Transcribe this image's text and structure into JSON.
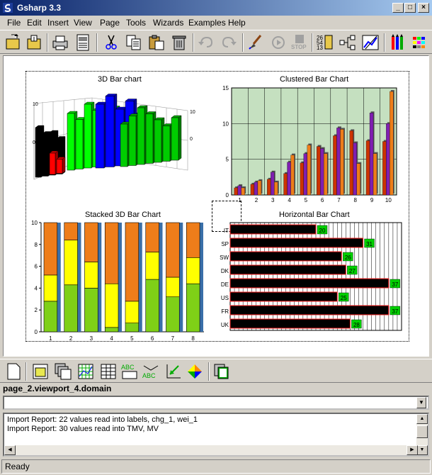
{
  "window": {
    "title": "Gsharp 3.3",
    "min": "_",
    "max": "□",
    "close": "×"
  },
  "menu": [
    "File",
    "Edit",
    "Insert",
    "View",
    "Page",
    "Tools",
    "Wizards",
    "Examples",
    "Help"
  ],
  "toolbar": [
    {
      "name": "open-icon"
    },
    {
      "name": "save-icon"
    },
    {
      "name": "print-icon"
    },
    {
      "name": "print-preview-icon"
    },
    {
      "name": "cut-icon"
    },
    {
      "name": "copy-icon"
    },
    {
      "name": "paste-icon"
    },
    {
      "name": "delete-icon"
    },
    {
      "name": "undo-icon"
    },
    {
      "name": "redo-icon"
    },
    {
      "name": "brush-icon"
    },
    {
      "name": "run-icon"
    },
    {
      "name": "stop-icon",
      "label": "STOP"
    },
    {
      "name": "data-icon"
    },
    {
      "name": "tree-icon"
    },
    {
      "name": "chart-edit-icon"
    },
    {
      "name": "pens-icon"
    },
    {
      "name": "palette-icon"
    }
  ],
  "charts": {
    "bar3d": {
      "title": "3D Bar chart",
      "ticks": [
        "10",
        "0",
        "0",
        "10"
      ]
    },
    "clustered": {
      "title": "Clustered Bar Chart"
    },
    "stacked": {
      "title": "Stacked 3D Bar Chart"
    },
    "horizontal": {
      "title": "Horizontal Bar Chart"
    }
  },
  "chart_data": [
    {
      "type": "bar",
      "title": "3D Bar chart",
      "series": [
        {
          "color": "#000000",
          "values": [
            7,
            6,
            6,
            5
          ]
        },
        {
          "color": "#ff0000",
          "values": [
            3,
            2
          ]
        },
        {
          "color": "#00ff00",
          "values": [
            8,
            7,
            9,
            8,
            7,
            8
          ]
        },
        {
          "color": "#0000ff",
          "values": [
            9,
            10,
            8,
            9,
            7
          ]
        },
        {
          "color": "#00cc00",
          "values": [
            6,
            7,
            8,
            7,
            6,
            5,
            6
          ]
        }
      ]
    },
    {
      "type": "bar",
      "title": "Clustered Bar Chart",
      "categories": [
        "1",
        "2",
        "3",
        "4",
        "5",
        "6",
        "7",
        "8",
        "9",
        "10"
      ],
      "ylim": [
        0,
        15
      ],
      "yticks": [
        "0",
        "5",
        "10",
        "15"
      ],
      "series": [
        {
          "color": "#cc3300",
          "values": [
            1,
            1.5,
            2.2,
            3.0,
            4.5,
            6.8,
            8.3,
            9.0,
            7.6,
            7.5
          ]
        },
        {
          "color": "#7f1fb0",
          "values": [
            1.3,
            1.8,
            3.2,
            4.6,
            5.8,
            6.5,
            9.4,
            7.3,
            11.5,
            10
          ]
        },
        {
          "color": "#ee7d1a",
          "values": [
            1.0,
            2.0,
            1.8,
            5.6,
            7.0,
            5.8,
            9.2,
            4.4,
            5.8,
            14.5
          ]
        }
      ]
    },
    {
      "type": "bar",
      "title": "Stacked 3D Bar Chart",
      "categories": [
        "1",
        "2",
        "3",
        "4",
        "5",
        "6",
        "7",
        "8"
      ],
      "ylim": [
        0,
        10
      ],
      "yticks": [
        "0",
        "2",
        "4",
        "6",
        "8",
        "10"
      ],
      "series": [
        {
          "color": "#7fd017",
          "values": [
            2.8,
            4.3,
            4.0,
            0.4,
            0.8,
            4.8,
            3.2,
            4.4
          ]
        },
        {
          "color": "#ffff00",
          "values": [
            2.4,
            4.1,
            2.4,
            4.0,
            2.0,
            2.5,
            1.8,
            2.4
          ]
        },
        {
          "color": "#ee7d1a",
          "values": [
            4.8,
            1.6,
            3.6,
            5.6,
            7.2,
            2.7,
            5.0,
            3.2
          ]
        }
      ]
    },
    {
      "type": "bar",
      "title": "Horizontal Bar Chart",
      "categories": [
        "IT",
        "SP",
        "SW",
        "DK",
        "DE",
        "US",
        "FR",
        "UK"
      ],
      "values": [
        20,
        31,
        26,
        27,
        37,
        25,
        37,
        28
      ],
      "labels": [
        "20",
        "31",
        "26",
        "27",
        "37",
        "25",
        "37",
        "28"
      ],
      "xlim": [
        0,
        40
      ]
    }
  ],
  "toolbar2": [
    {
      "name": "new-page-icon"
    },
    {
      "name": "new-viewport-icon"
    },
    {
      "name": "viewports-icon"
    },
    {
      "name": "grid-icon"
    },
    {
      "name": "table-icon"
    },
    {
      "name": "text-abc-icon"
    },
    {
      "name": "text-abc2-icon"
    },
    {
      "name": "axis-icon"
    },
    {
      "name": "pie-icon"
    },
    {
      "name": "copy-page-icon"
    }
  ],
  "viewport_label": "page_2.viewport_4.domain",
  "command_value": "",
  "log": [
    "Import Report: 22 values read into  labels, chg_1, wei_1",
    "Import Report: 30 values read into  TMV, MV"
  ],
  "status": "Ready"
}
